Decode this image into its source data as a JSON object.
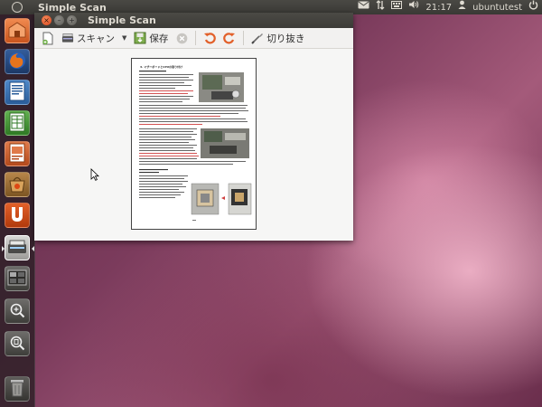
{
  "panel": {
    "app_title": "Simple Scan",
    "time": "21:17",
    "user": "ubuntutest"
  },
  "window": {
    "title": "Simple Scan"
  },
  "toolbar": {
    "scan_label": "スキャン",
    "save_label": "保存",
    "crop_label": "切り抜き"
  },
  "document": {
    "heading": "3. マザーボードとCPUの取り付け"
  },
  "colors": {
    "panel_bg": "#3c3b37",
    "accent_orange": "#dd4814",
    "launcher_bg": "#2a1f25"
  },
  "launcher": {
    "items": [
      {
        "icon": "home-folder-icon"
      },
      {
        "icon": "firefox-icon"
      },
      {
        "icon": "writer-icon"
      },
      {
        "icon": "calc-icon"
      },
      {
        "icon": "impress-icon"
      },
      {
        "icon": "software-center-icon"
      },
      {
        "icon": "ubuntu-one-icon"
      },
      {
        "icon": "simple-scan-icon"
      },
      {
        "icon": "workspace-switcher-icon"
      },
      {
        "icon": "lens-apps-icon"
      },
      {
        "icon": "lens-files-icon"
      },
      {
        "icon": "trash-icon"
      }
    ]
  }
}
